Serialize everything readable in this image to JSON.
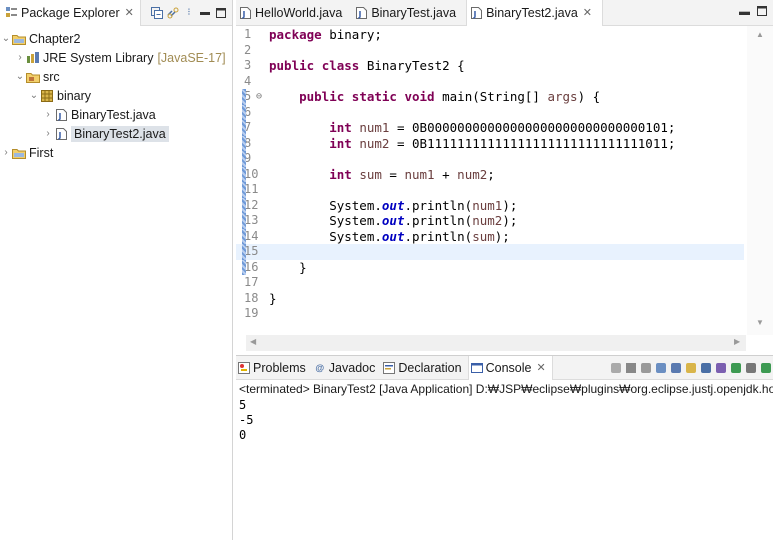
{
  "package_explorer": {
    "title": "Package Explorer",
    "tree": [
      {
        "label": "Chapter2",
        "icon": "project-folder-icon",
        "expanded": true,
        "depth": 0
      },
      {
        "label": "JRE System Library",
        "decoration": "[JavaSE-17]",
        "icon": "library-icon",
        "expanded": false,
        "depth": 1
      },
      {
        "label": "src",
        "icon": "source-folder-icon",
        "expanded": true,
        "depth": 1
      },
      {
        "label": "binary",
        "icon": "package-icon",
        "expanded": true,
        "depth": 2
      },
      {
        "label": "BinaryTest.java",
        "icon": "java-file-icon",
        "expanded": false,
        "depth": 3
      },
      {
        "label": "BinaryTest2.java",
        "icon": "java-file-icon",
        "expanded": false,
        "depth": 3,
        "selected": true
      },
      {
        "label": "First",
        "icon": "project-folder-icon",
        "expanded": false,
        "depth": 0
      }
    ]
  },
  "editor": {
    "tabs": [
      {
        "label": "HelloWorld.java",
        "active": false
      },
      {
        "label": "BinaryTest.java",
        "active": false
      },
      {
        "label": "BinaryTest2.java",
        "active": true
      }
    ],
    "current_line": 15,
    "lines": [
      {
        "n": "1",
        "text": "package binary;"
      },
      {
        "n": "2",
        "text": ""
      },
      {
        "n": "3",
        "text": "public class BinaryTest2 {"
      },
      {
        "n": "4",
        "text": ""
      },
      {
        "n": "5",
        "text": "    public static void main(String[] args) {"
      },
      {
        "n": "6",
        "text": ""
      },
      {
        "n": "7",
        "text": "        int num1 = 0B00000000000000000000000000000101;"
      },
      {
        "n": "8",
        "text": "        int num2 = 0B11111111111111111111111111111011;"
      },
      {
        "n": "9",
        "text": ""
      },
      {
        "n": "10",
        "text": "        int sum = num1 + num2;"
      },
      {
        "n": "11",
        "text": ""
      },
      {
        "n": "12",
        "text": "        System.out.println(num1);"
      },
      {
        "n": "13",
        "text": "        System.out.println(num2);"
      },
      {
        "n": "14",
        "text": "        System.out.println(sum);"
      },
      {
        "n": "15",
        "text": ""
      },
      {
        "n": "16",
        "text": "    }"
      },
      {
        "n": "17",
        "text": ""
      },
      {
        "n": "18",
        "text": "}"
      },
      {
        "n": "19",
        "text": ""
      }
    ]
  },
  "bottom_panel": {
    "tabs": [
      {
        "label": "Problems",
        "icon": "problems-icon",
        "active": false
      },
      {
        "label": "Javadoc",
        "icon": "javadoc-icon",
        "active": false
      },
      {
        "label": "Declaration",
        "icon": "declaration-icon",
        "active": false
      },
      {
        "label": "Console",
        "icon": "console-icon",
        "active": true
      }
    ],
    "status": "<terminated> BinaryTest2 [Java Application] D:₩JSP₩eclipse₩plugins₩org.eclipse.justj.openjdk.ho",
    "output": [
      "5",
      "-5",
      "0"
    ]
  },
  "colors": {
    "keyword": "#7f0055",
    "local_var": "#6a3e3e",
    "static_field": "#0000c0",
    "current_line_bg": "#e8f2fe",
    "selection_bg": "#dde2e8"
  }
}
